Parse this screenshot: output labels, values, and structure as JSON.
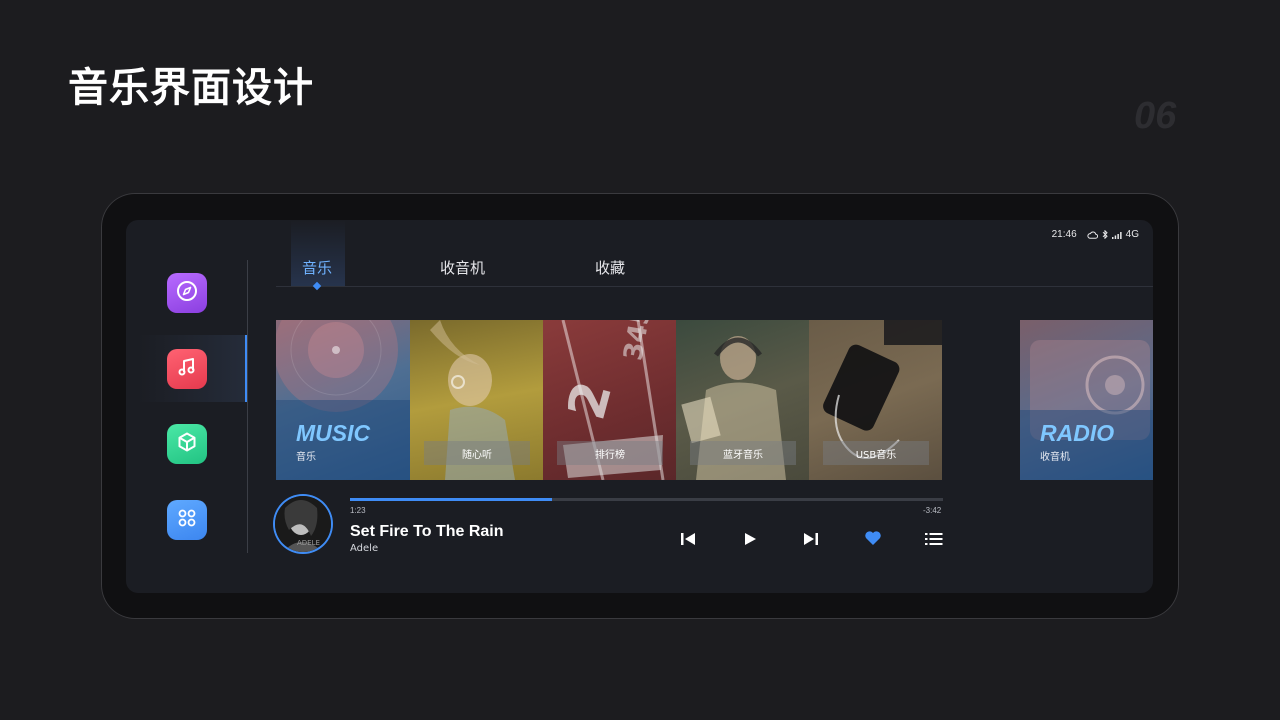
{
  "page": {
    "title": "音乐界面设计",
    "number": "06"
  },
  "status_bar": {
    "time": "21:46",
    "network": "4G",
    "icons": [
      "cloud-icon",
      "bluetooth-icon",
      "signal-icon"
    ]
  },
  "dock": {
    "items": [
      {
        "name": "navigation",
        "icon": "compass-icon",
        "color": "#a855f7"
      },
      {
        "name": "music",
        "icon": "music-note-icon",
        "color": "#ef4a5c",
        "active": true
      },
      {
        "name": "box",
        "icon": "cube-icon",
        "color": "#3ddc97"
      },
      {
        "name": "apps",
        "icon": "apps-grid-icon",
        "color": "#4b9bff"
      }
    ]
  },
  "tabs": [
    {
      "label": "音乐",
      "active": true
    },
    {
      "label": "收音机",
      "active": false
    },
    {
      "label": "收藏",
      "active": false
    }
  ],
  "cards": [
    {
      "big_label": "MUSIC",
      "sub_label": "音乐"
    },
    {
      "label": "随心听"
    },
    {
      "label": "排行榜"
    },
    {
      "label": "蓝牙音乐"
    },
    {
      "label": "USB音乐"
    },
    {
      "big_label": "RADIO",
      "sub_label": "收音机"
    }
  ],
  "player": {
    "title": "Set Fire To The Rain",
    "artist": "Adele",
    "album_text": "ADELE",
    "elapsed": "1:23",
    "remaining": "-3:42",
    "progress": 0.34,
    "controls": [
      "previous-icon",
      "play-icon",
      "next-icon",
      "heart-icon",
      "playlist-icon"
    ],
    "favorite": true
  },
  "colors": {
    "accent": "#3f8cf5",
    "background": "#1c1c1f",
    "screen": "#1b1d23"
  }
}
